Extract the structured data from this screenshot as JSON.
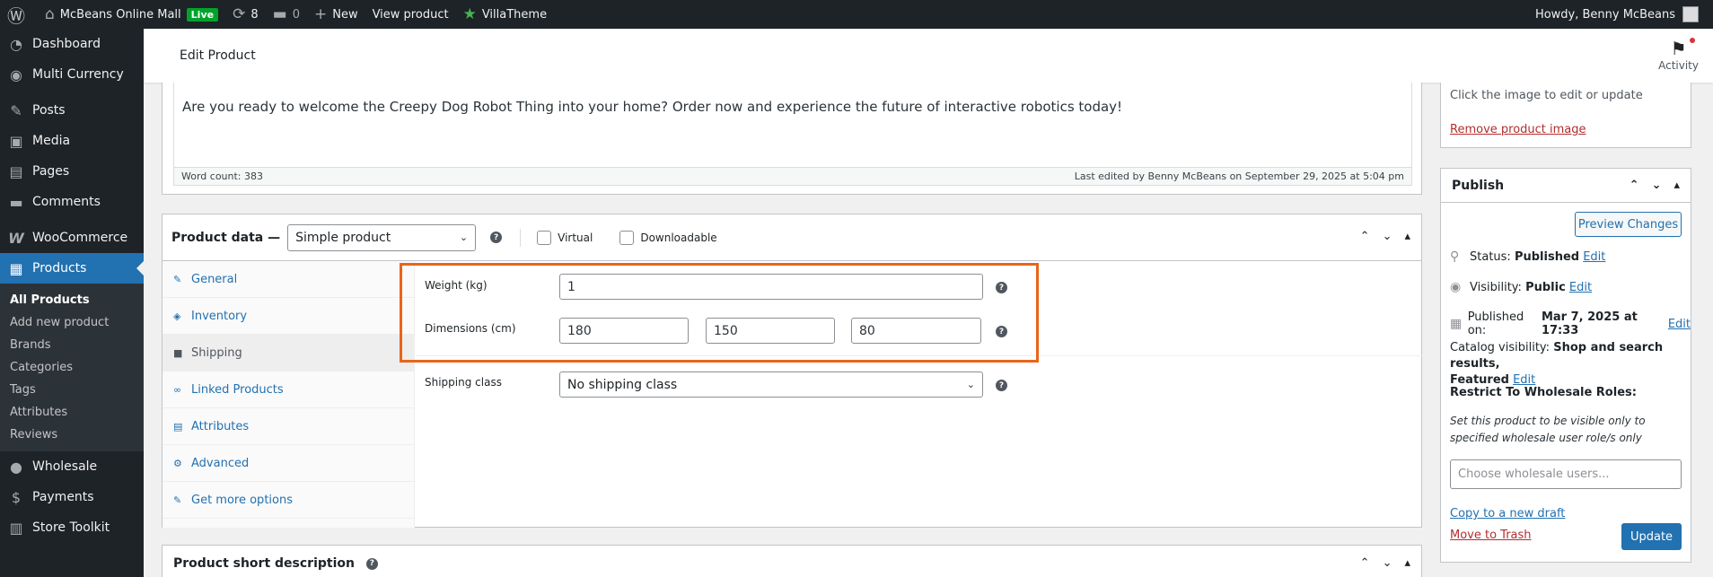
{
  "adminbar": {
    "site_name": "McBeans Online Mall",
    "live_label": "Live",
    "updates_count": "8",
    "comments_count": "0",
    "new_label": "New",
    "view_product_label": "View product",
    "villatheme_label": "VillaTheme",
    "howdy": "Howdy, Benny McBeans"
  },
  "sidebar": {
    "items": [
      {
        "label": "Dashboard",
        "icon": "dashboard-icon"
      },
      {
        "label": "Multi Currency",
        "icon": "currency-icon"
      },
      {
        "label": "Posts",
        "icon": "pin-icon"
      },
      {
        "label": "Media",
        "icon": "media-icon"
      },
      {
        "label": "Pages",
        "icon": "page-icon"
      },
      {
        "label": "Comments",
        "icon": "comment-icon"
      },
      {
        "label": "WooCommerce",
        "icon": "woo-icon"
      },
      {
        "label": "Products",
        "icon": "products-icon"
      },
      {
        "label": "Wholesale",
        "icon": "wholesale-icon"
      },
      {
        "label": "Payments",
        "icon": "payments-icon"
      },
      {
        "label": "Store Toolkit",
        "icon": "toolkit-icon"
      }
    ],
    "submenu": [
      "All Products",
      "Add new product",
      "Brands",
      "Categories",
      "Tags",
      "Attributes",
      "Reviews"
    ]
  },
  "header": {
    "title": "Edit Product",
    "activity_label": "Activity"
  },
  "description": {
    "text": "Are you ready to welcome the Creepy Dog Robot Thing into your home? Order now and experience the future of interactive robotics today!",
    "word_count": "Word count: 383",
    "last_edited": "Last edited by Benny McBeans on September 29, 2025 at 5:04 pm"
  },
  "product_data": {
    "title": "Product data —",
    "type_selected": "Simple product",
    "virtual_label": "Virtual",
    "downloadable_label": "Downloadable",
    "tabs": [
      "General",
      "Inventory",
      "Shipping",
      "Linked Products",
      "Attributes",
      "Advanced",
      "Get more options"
    ],
    "active_tab": "Shipping",
    "shipping": {
      "weight_label": "Weight (kg)",
      "weight_value": "1",
      "dimensions_label": "Dimensions (cm)",
      "length": "180",
      "width": "150",
      "height": "80",
      "class_label": "Shipping class",
      "class_value": "No shipping class"
    }
  },
  "short_description": {
    "title": "Product short description"
  },
  "image_box": {
    "hint": "Click the image to edit or update",
    "remove_label": "Remove product image"
  },
  "publish": {
    "title": "Publish",
    "preview_label": "Preview Changes",
    "status_label": "Status:",
    "status_value": "Published",
    "visibility_label": "Visibility:",
    "visibility_value": "Public",
    "published_on_label": "Published on:",
    "published_on_value": "Mar 7, 2025 at 17:33",
    "catalog_label": "Catalog visibility:",
    "catalog_value": "Shop and search results,",
    "catalog_value2": "Featured",
    "edit_label": "Edit",
    "restrict_title": "Restrict To Wholesale Roles:",
    "restrict_desc": "Set this product to be visible only to specified wholesale user role/s only",
    "wholesale_placeholder": "Choose wholesale users...",
    "copy_draft_label": "Copy to a new draft",
    "trash_label": "Move to Trash",
    "update_label": "Update"
  }
}
